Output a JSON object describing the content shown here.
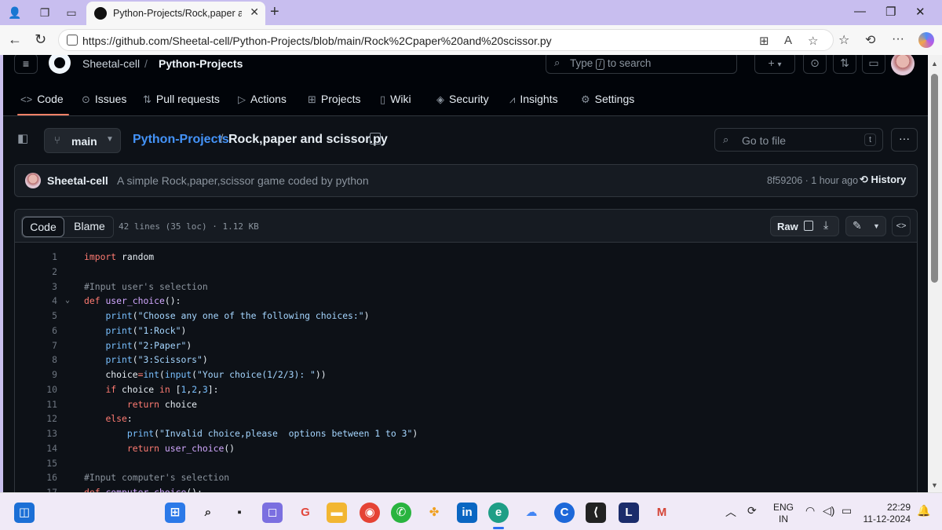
{
  "browser": {
    "tab_title": "Python-Projects/Rock,paper and scissor.py",
    "url": "https://github.com/Sheetal-cell/Python-Projects/blob/main/Rock%2Cpaper%20and%20scissor.py"
  },
  "header": {
    "owner": "Sheetal-cell",
    "separator": "/",
    "repo": "Python-Projects",
    "search_prefix": "Type",
    "search_key": "/",
    "search_suffix": "to search",
    "plus": "+",
    "plus_caret": "▾"
  },
  "repo_nav": [
    {
      "label": "Code",
      "icon": "code-icon"
    },
    {
      "label": "Issues",
      "icon": "issue-icon"
    },
    {
      "label": "Pull requests",
      "icon": "pull-request-icon"
    },
    {
      "label": "Actions",
      "icon": "play-icon"
    },
    {
      "label": "Projects",
      "icon": "table-icon"
    },
    {
      "label": "Wiki",
      "icon": "book-icon"
    },
    {
      "label": "Security",
      "icon": "shield-icon"
    },
    {
      "label": "Insights",
      "icon": "graph-icon"
    },
    {
      "label": "Settings",
      "icon": "gear-icon"
    }
  ],
  "file_header": {
    "branch": "main",
    "path_repo": "Python-Projects",
    "path_sep": "/",
    "file_name": "Rock,paper and scissor.py",
    "goto_placeholder": "Go to file",
    "goto_key": "t"
  },
  "commit": {
    "author": "Sheetal-cell",
    "message": "A simple Rock,paper,scissor game coded by python",
    "meta": "8f59206 · 1 hour ago",
    "history_label": "History"
  },
  "code_toolbar": {
    "code_tab": "Code",
    "blame_tab": "Blame",
    "stats": "42 lines (35 loc) · 1.12 KB",
    "raw_label": "Raw"
  },
  "taskbar": {
    "lang_line1": "ENG",
    "lang_line2": "IN",
    "time": "22:29",
    "date": "11-12-2024"
  },
  "colors": {
    "accent": "#f78166",
    "link": "#4493f8",
    "background": "#0d1117"
  }
}
